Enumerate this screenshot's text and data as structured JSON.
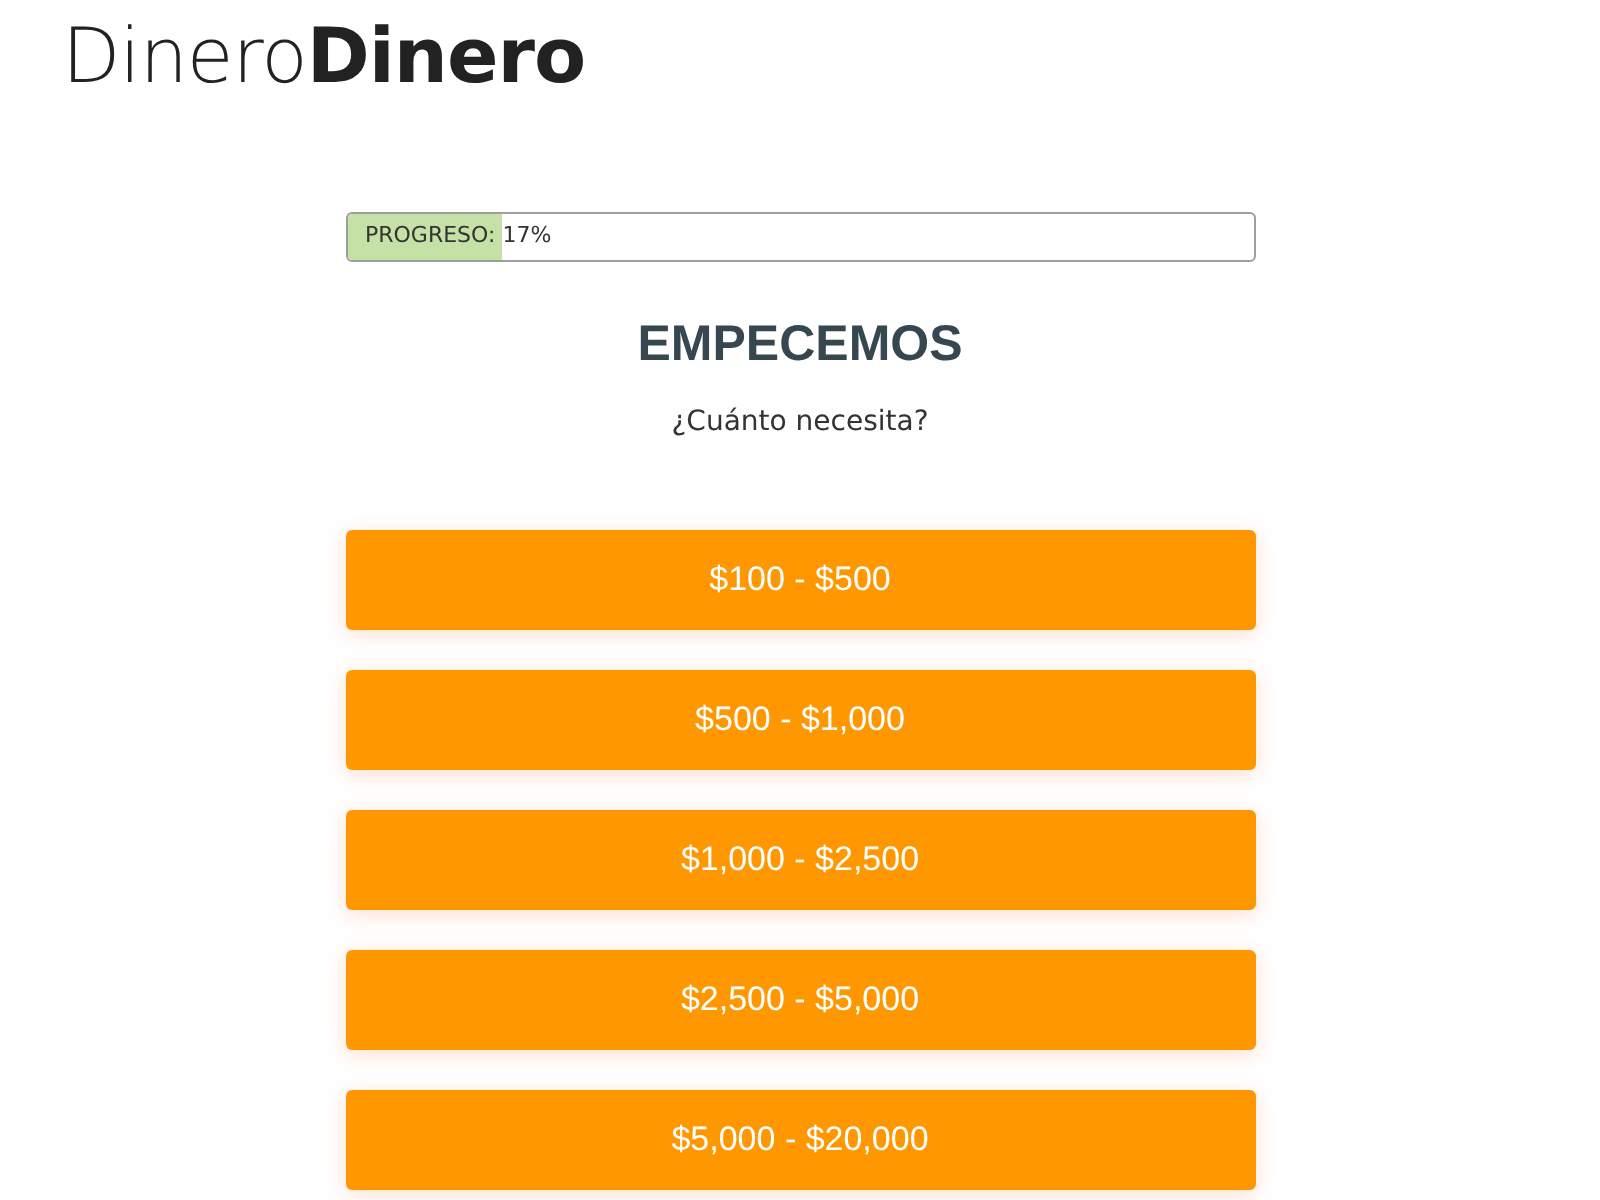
{
  "logo": {
    "text": "Dinero**Dinero**"
  },
  "progress": {
    "label": "PROGRESO:",
    "reading": "17%",
    "level": 0.17
  },
  "heading": "EMPECEMOS",
  "question": "¿Cuánto necesita?",
  "options": [
    {
      "label": "$100 - $500"
    },
    {
      "label": "$500 - $1,000"
    },
    {
      "label": "$1,000 - $2,500"
    },
    {
      "label": "$2,500 - $5,000"
    },
    {
      "label": "$5,000 - $20,000"
    }
  ]
}
